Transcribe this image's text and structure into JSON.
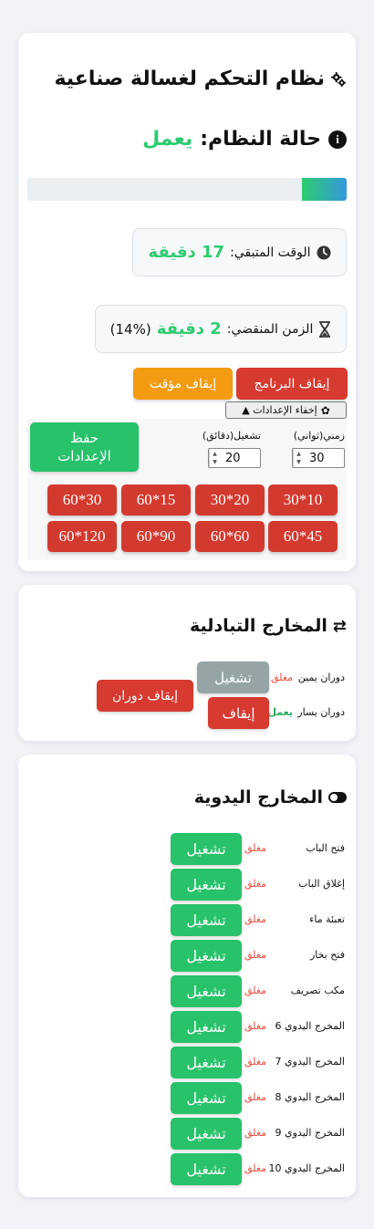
{
  "header": {
    "title": "نظام التحكم لغسالة صناعية"
  },
  "status": {
    "label": "حالة النظام:",
    "value": "يعمل"
  },
  "progress": {
    "fraction": 0.14
  },
  "remaining": {
    "label": "الوقت المتبقي:",
    "value": "17 دقيقة"
  },
  "elapsed": {
    "label": "الزمن المنقضي:",
    "value": "2 دقيقة",
    "percent": "(14%)"
  },
  "controls": {
    "stop_program": "إيقاف البرنامج",
    "pause": "إيقاف مؤقت",
    "hide_settings": "إخفاء الإعدادات ▲"
  },
  "settings": {
    "time_label": "زمني(ثواني)",
    "time_value": "30",
    "run_label": "تشغيل(دقائق)",
    "run_value": "20",
    "save_label": "حفظ الإعدادات",
    "presets": [
      "10*30",
      "20*30",
      "15*60",
      "30*60",
      "45*60",
      "60*60",
      "90*60",
      "120*60"
    ]
  },
  "swap": {
    "title": "المخارج التبادلية",
    "right_label": "دوران يمين",
    "right_state": "مغلق",
    "right_button": "تشغيل",
    "left_label": "دوران يسار",
    "left_state": "يعمل",
    "left_button": "إيقاف",
    "stop_rotation": "إيقاف دوران"
  },
  "manual": {
    "title": "المخارج اليدوية",
    "button_label": "تشغيل",
    "items": [
      {
        "label": "فتح الباب",
        "state": "مغلق"
      },
      {
        "label": "إغلاق الباب",
        "state": "مغلق"
      },
      {
        "label": "تعبئة ماء",
        "state": "مغلق"
      },
      {
        "label": "فتح بخار",
        "state": "مغلق"
      },
      {
        "label": "مكب تصريف",
        "state": "مغلق"
      },
      {
        "label": "المخرج اليدوي 6",
        "state": "مغلق"
      },
      {
        "label": "المخرج اليدوي 7",
        "state": "مغلق"
      },
      {
        "label": "المخرج اليدوي 8",
        "state": "مغلق"
      },
      {
        "label": "المخرج اليدوي 9",
        "state": "مغلق"
      },
      {
        "label": "المخرج اليدوي 10",
        "state": "مغلق"
      }
    ]
  },
  "colors": {
    "green": "#2ecc71",
    "red": "#d63a30",
    "orange": "#f39c12",
    "gray": "#95a5a6"
  }
}
